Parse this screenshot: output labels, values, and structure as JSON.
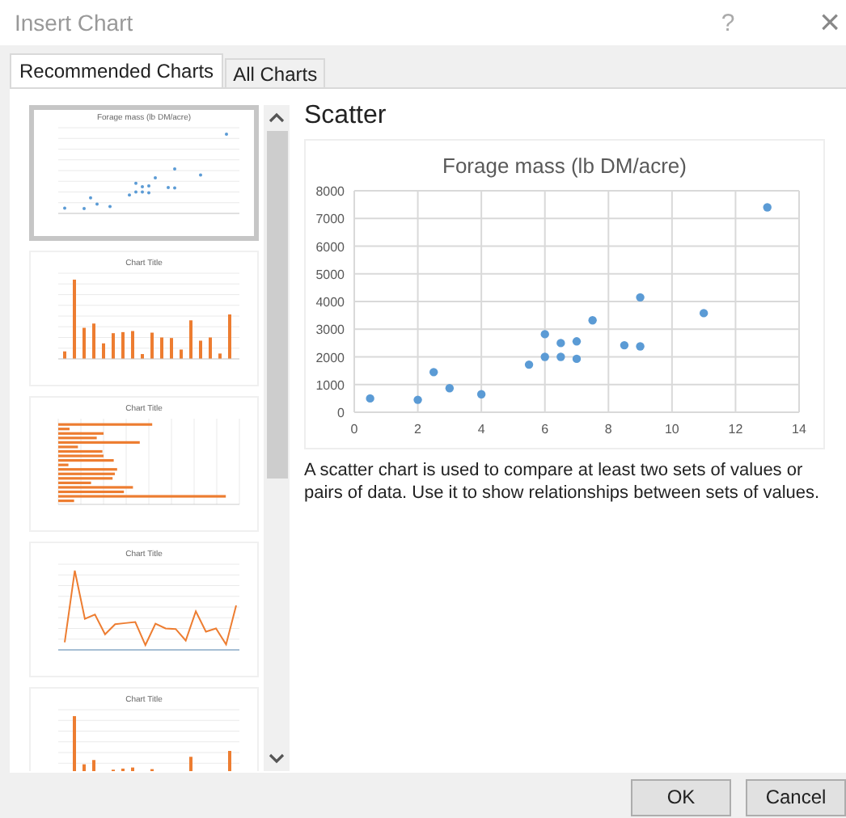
{
  "window": {
    "title": "Insert Chart",
    "help": "?",
    "close": "×"
  },
  "tabs": [
    {
      "label": "Recommended Charts",
      "selected": true
    },
    {
      "label": "All Charts",
      "selected": false
    }
  ],
  "thumbnails": [
    {
      "kind": "scatter",
      "title": "Forage mass (lb DM/acre)",
      "selected": true
    },
    {
      "kind": "column",
      "title": "Chart Title",
      "selected": false
    },
    {
      "kind": "bar",
      "title": "Chart Title",
      "selected": false
    },
    {
      "kind": "line",
      "title": "Chart Title",
      "selected": false
    },
    {
      "kind": "column",
      "title": "Chart Title",
      "selected": false
    }
  ],
  "preview": {
    "heading": "Scatter",
    "description": "A scatter chart is used to compare at least two sets of values or pairs of data. Use it to show relationships between sets of values.",
    "chart_data": {
      "type": "scatter",
      "title": "Forage mass (lb DM/acre)",
      "xlim": [
        0,
        14
      ],
      "ylim": [
        0,
        8000
      ],
      "xticks": [
        0,
        2,
        4,
        6,
        8,
        10,
        12,
        14
      ],
      "yticks": [
        0,
        1000,
        2000,
        3000,
        4000,
        5000,
        6000,
        7000,
        8000
      ],
      "x": [
        0.5,
        2,
        2.5,
        3,
        4,
        5.5,
        6,
        6,
        6.5,
        6.5,
        7,
        7,
        7.5,
        8.5,
        9,
        9,
        11,
        13
      ],
      "grid": true,
      "series": [
        {
          "color": "#5b9bd5",
          "values": [
            500,
            450,
            1450,
            870,
            650,
            1720,
            2000,
            2820,
            2000,
            2500,
            1930,
            2560,
            3320,
            2420,
            2380,
            4150,
            3580,
            7400
          ]
        }
      ]
    }
  },
  "buttons": [
    "OK",
    "Cancel"
  ]
}
